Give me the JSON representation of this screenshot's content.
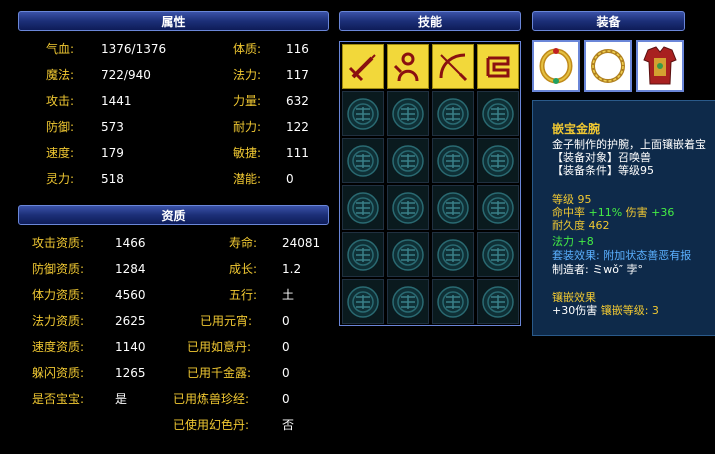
{
  "headers": {
    "attributes": "属性",
    "skills": "技能",
    "equipment": "装备",
    "aptitude": "资质"
  },
  "attributes": [
    {
      "label": "气血:",
      "value": "1376/1376"
    },
    {
      "label": "魔法:",
      "value": "722/940"
    },
    {
      "label": "攻击:",
      "value": "1441"
    },
    {
      "label": "防御:",
      "value": "573"
    },
    {
      "label": "速度:",
      "value": "179"
    },
    {
      "label": "灵力:",
      "value": "518"
    },
    {
      "label": "体质:",
      "value": "116"
    },
    {
      "label": "法力:",
      "value": "117"
    },
    {
      "label": "力量:",
      "value": "632"
    },
    {
      "label": "耐力:",
      "value": "122"
    },
    {
      "label": "敏捷:",
      "value": "111"
    },
    {
      "label": "潜能:",
      "value": "0"
    }
  ],
  "aptitude": [
    {
      "label": "攻击资质:",
      "value": "1466"
    },
    {
      "label": "防御资质:",
      "value": "1284"
    },
    {
      "label": "体力资质:",
      "value": "4560"
    },
    {
      "label": "法力资质:",
      "value": "2625"
    },
    {
      "label": "速度资质:",
      "value": "1140"
    },
    {
      "label": "躲闪资质:",
      "value": "1265"
    },
    {
      "label": "是否宝宝:",
      "value": "是"
    },
    {
      "label": "寿命:",
      "value": "24081"
    },
    {
      "label": "成长:",
      "value": "1.2"
    },
    {
      "label": "五行:",
      "value": "土"
    },
    {
      "label": "已用元宵:",
      "value": "0"
    },
    {
      "label": "已用如意丹:",
      "value": "0"
    },
    {
      "label": "已用千金露:",
      "value": "0"
    },
    {
      "label": "已用炼兽珍经:",
      "value": "0"
    },
    {
      "label": "已使用幻色丹:",
      "value": "否"
    }
  ],
  "skills": [
    "sword-icon",
    "figure-icon",
    "bow-icon",
    "scroll-icon"
  ],
  "equipment": [
    "bracelet-icon",
    "necklace-icon",
    "armor-icon"
  ],
  "tooltip": {
    "name": "嵌宝金腕",
    "desc": "金子制作的护腕，上面镶嵌着宝",
    "target": "【装备对象】召唤兽",
    "condition": "【装备条件】等级95",
    "level": "等级 95",
    "hit_label": "命中率 ",
    "hit_value": "+11%",
    "dmg_label": " 伤害 ",
    "dmg_value": "+36",
    "durability": "耐久度 462",
    "magic": "法力 +8",
    "set_effect": "套装效果: 附加状态善恶有报",
    "maker": "制造者: ミwǒ″ 孛°",
    "inlay_title": "镶嵌效果",
    "inlay_dmg": "+30伤害 ",
    "inlay_level": "镶嵌等级: 3"
  }
}
